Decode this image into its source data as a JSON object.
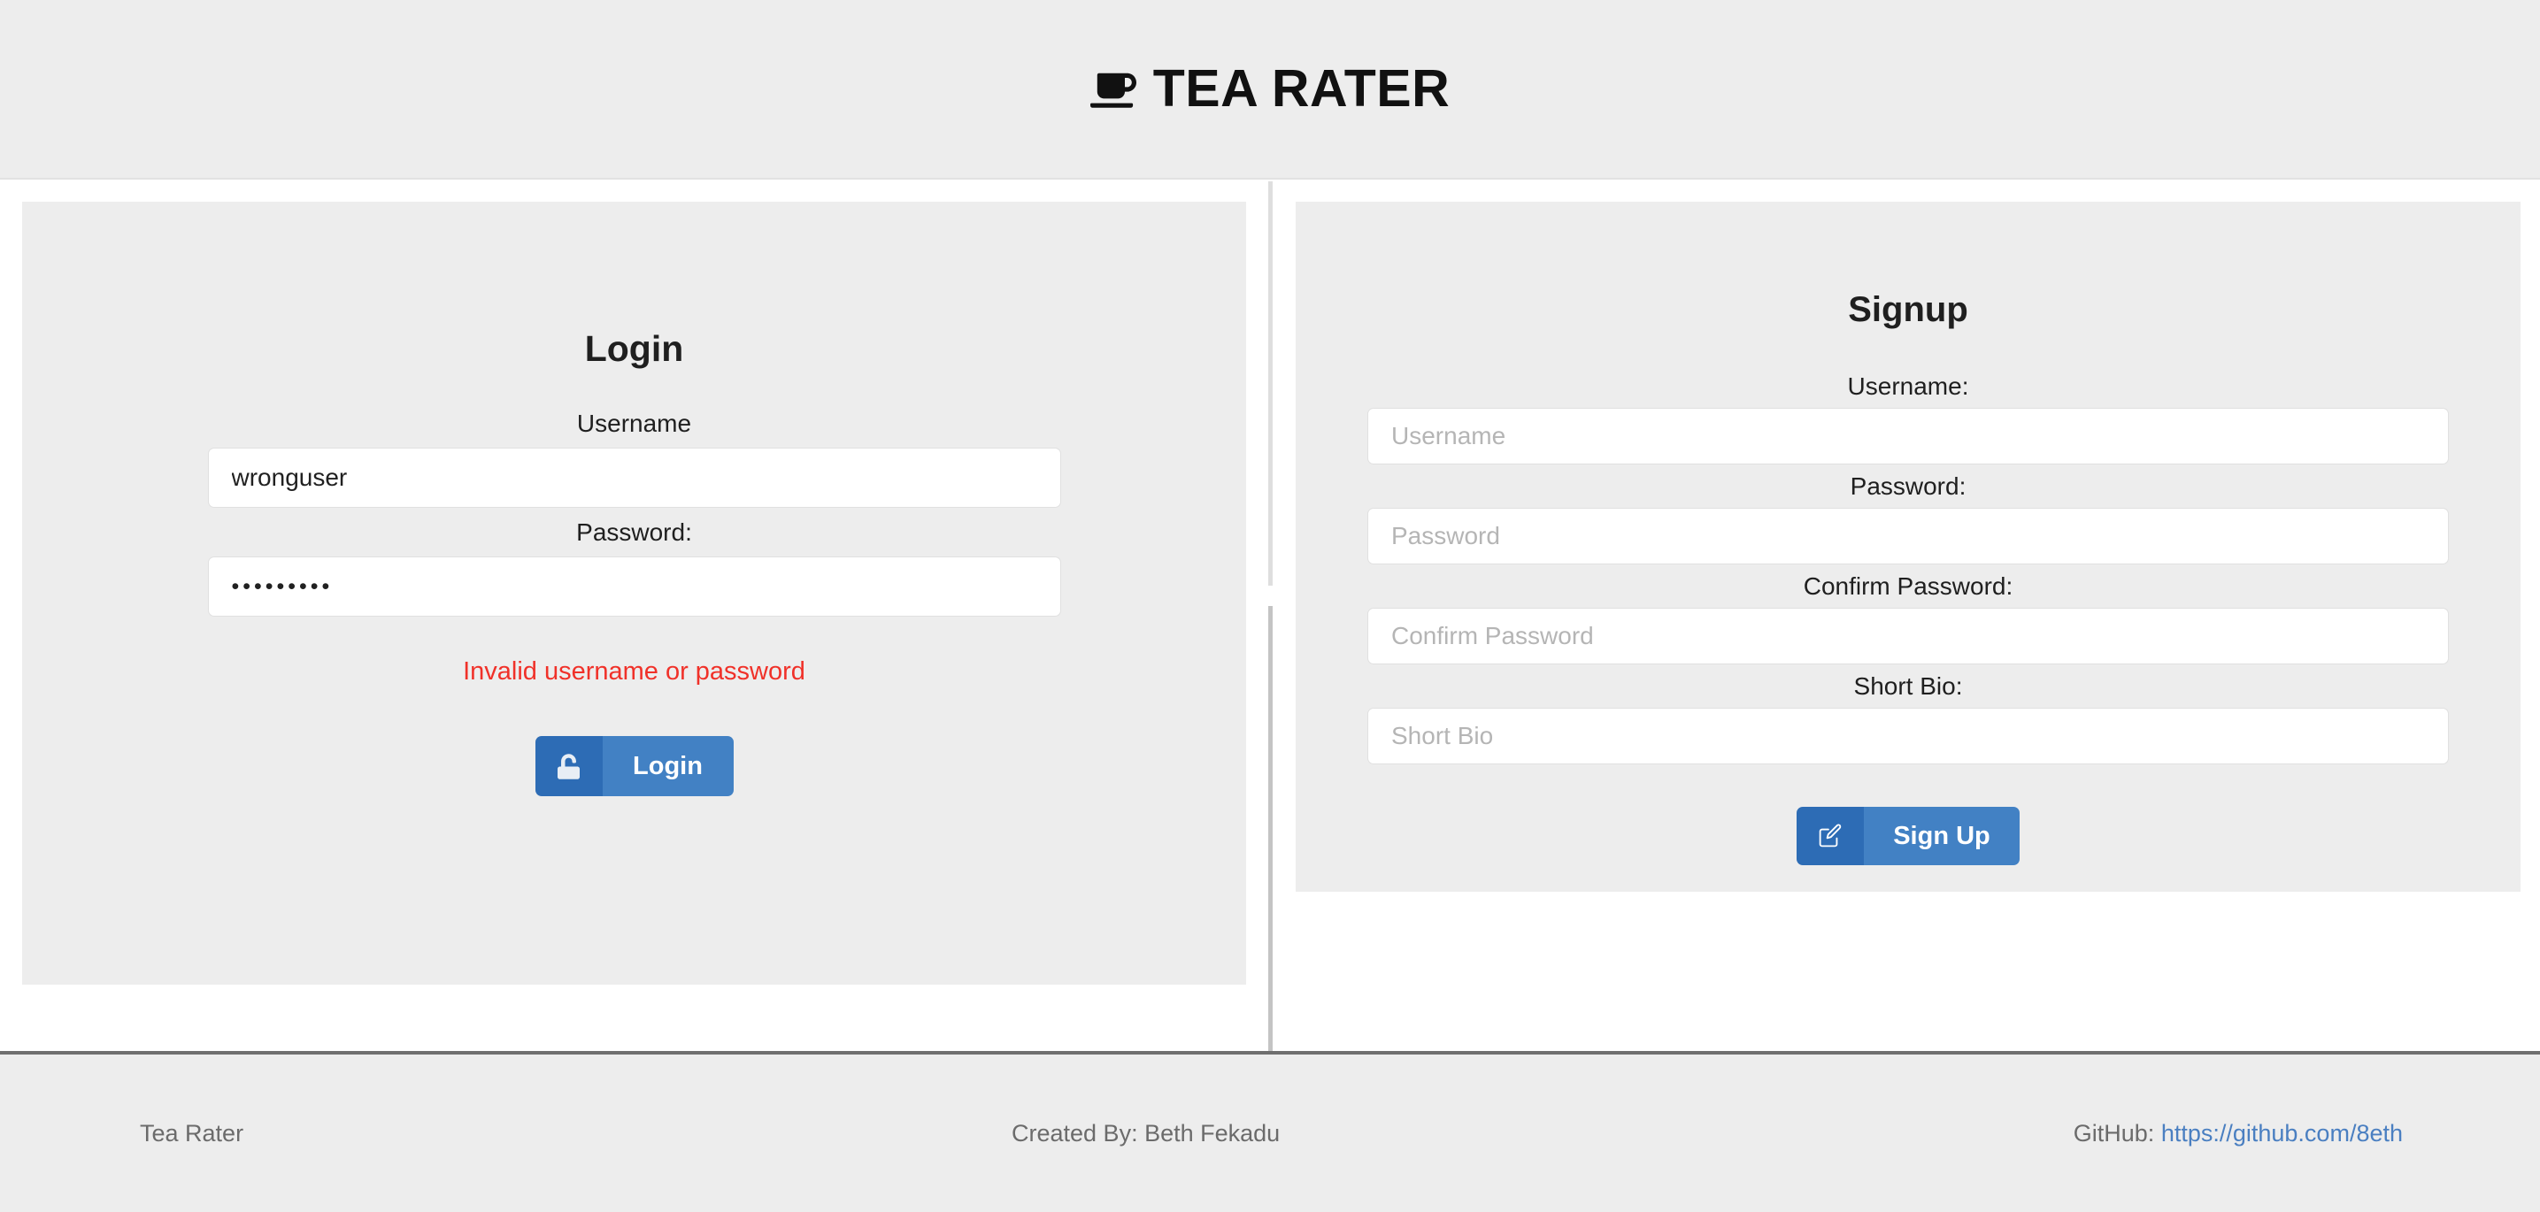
{
  "header": {
    "brand_title": "TEA RATER",
    "brand_icon": "coffee-cup-icon"
  },
  "login": {
    "heading": "Login",
    "username_label": "Username",
    "username_value": "wronguser",
    "password_label": "Password:",
    "password_masked": "•••••••••",
    "password_char_count": 9,
    "error_message": "Invalid username or password",
    "button_label": "Login",
    "button_icon": "unlock-icon"
  },
  "signup": {
    "heading": "Signup",
    "username_label": "Username:",
    "username_placeholder": "Username",
    "username_value": "",
    "password_label": "Password:",
    "password_placeholder": "Password",
    "password_value": "",
    "confirm_password_label": "Confirm Password:",
    "confirm_password_placeholder": "Confirm Password",
    "confirm_password_value": "",
    "bio_label": "Short Bio:",
    "bio_placeholder": "Short Bio",
    "bio_value": "",
    "button_label": "Sign Up",
    "button_icon": "edit-pen-square-icon"
  },
  "footer": {
    "site_name": "Tea Rater",
    "credit": "Created By: Beth Fekadu",
    "github_label": "GitHub:",
    "github_url": "https://github.com/8eth"
  },
  "colors": {
    "page_background": "#ffffff",
    "panel_background": "#ededed",
    "button_primary": "#4281c4",
    "button_primary_dark": "#2d6cb5",
    "error_text": "#f03129",
    "link": "#4a7fc1",
    "footer_text": "#6b6b6b",
    "divider_top": "#dedede",
    "divider_bottom": "#c4c4c4"
  }
}
